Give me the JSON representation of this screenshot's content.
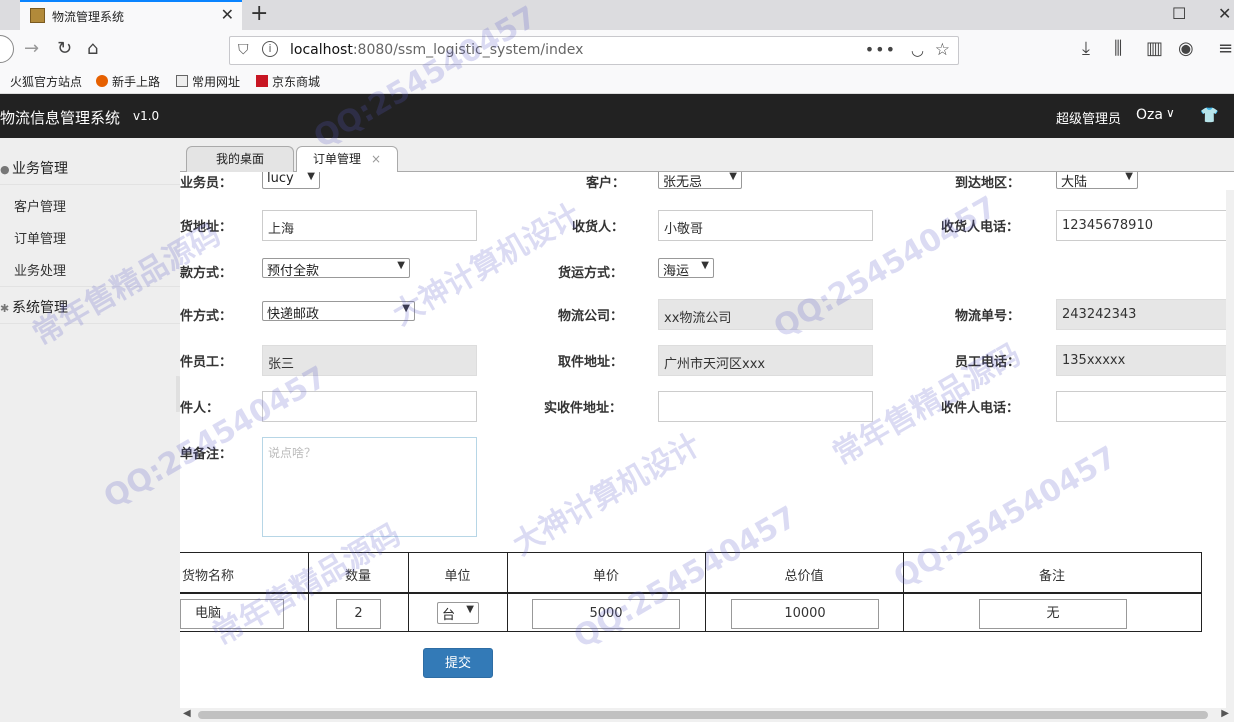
{
  "browser": {
    "tab_title": "物流管理系统",
    "url_host": "localhost",
    "url_rest": ":8080/ssm_logistic_system/index",
    "more_dots": "•••",
    "bookmarks": [
      "火狐官方站点",
      "新手上路",
      "常用网址",
      "京东商城"
    ]
  },
  "app": {
    "title": "物流信息管理系统",
    "version": "v1.0",
    "user_role": "超级管理员",
    "user_name": "Oza"
  },
  "sidebar": {
    "groups": [
      {
        "label": "业务管理",
        "items": [
          "客户管理",
          "订单管理",
          "业务处理"
        ]
      },
      {
        "label": "系统管理",
        "items": []
      }
    ]
  },
  "content_tabs": [
    "我的桌面",
    "订单管理"
  ],
  "form": {
    "salesman_label": "业务员：",
    "salesman_value": "lucy",
    "customer_label": "客户：",
    "customer_value": "张无忌",
    "area_label": "到达地区：",
    "area_value": "大陆",
    "ship_address_label": "货地址：",
    "ship_address_value": "上海",
    "receiver_label": "收货人：",
    "receiver_value": "小敬哥",
    "receiver_phone_label": "收货人电话：",
    "receiver_phone_value": "12345678910",
    "payment_label": "款方式：",
    "payment_value": "预付全款",
    "freight_label": "货运方式：",
    "freight_value": "海运",
    "pickup_method_label": "件方式：",
    "pickup_method_value": "快递邮政",
    "logistics_company_label": "物流公司：",
    "logistics_company_value": "xx物流公司",
    "logistics_no_label": "物流单号：",
    "logistics_no_value": "243242343",
    "pickup_staff_label": "件员工：",
    "pickup_staff_value": "张三",
    "pickup_address_label": "取件地址：",
    "pickup_address_value": "广州市天河区xxx",
    "staff_phone_label": "员工电话：",
    "staff_phone_value": "135xxxxx",
    "actual_receiver_label": "件人：",
    "actual_address_label": "实收件地址：",
    "actual_phone_label": "收件人电话：",
    "remark_label": "单备注：",
    "remark_placeholder": "说点啥？"
  },
  "goods": {
    "headers": [
      "货物名称",
      "数量",
      "单位",
      "单价",
      "总价值",
      "备注"
    ],
    "row": {
      "name": "电脑",
      "qty": "2",
      "unit": "台",
      "price": "5000",
      "total": "10000",
      "note": "无"
    }
  },
  "submit_label": "提交",
  "watermark": [
    "QQ:254540457",
    "常年售精品源码",
    "大神计算机设计"
  ]
}
